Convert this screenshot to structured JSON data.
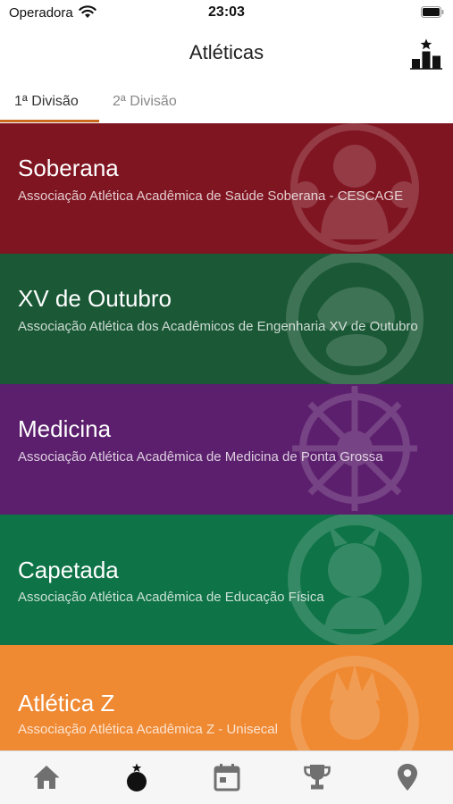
{
  "status_bar": {
    "carrier": "Operadora",
    "time": "23:03"
  },
  "header": {
    "title": "Atléticas",
    "action_icon": "ranking-podium-icon"
  },
  "tabs": [
    {
      "label": "1ª Divisão",
      "active": true
    },
    {
      "label": "2ª Divisão",
      "active": false
    }
  ],
  "colors": {
    "accent": "#c76a1e",
    "tab_bar_active": "#111111",
    "tab_bar_inactive": "#707070"
  },
  "athletics": [
    {
      "name": "Soberana",
      "description": "Associação Atlética Acadêmica de Saúde Soberana - CESCAGE",
      "color": "#7f1521"
    },
    {
      "name": "XV de Outubro",
      "description": "Associação Atlética dos Acadêmicos de Engenharia XV de Outubro",
      "color": "#1a5836"
    },
    {
      "name": "Medicina",
      "description": "Associação Atlética Acadêmica de Medicina de Ponta Grossa",
      "color": "#5c1f6d"
    },
    {
      "name": "Capetada",
      "description": "Associação Atlética Acadêmica de Educação Física",
      "color": "#0e7346"
    },
    {
      "name": "Atlética Z",
      "description": "Associação Atlética Acadêmica Z - Unisecal",
      "color": "#ef8932"
    }
  ],
  "tab_bar": [
    {
      "icon": "home-icon",
      "active": false
    },
    {
      "icon": "athletics-icon",
      "active": true
    },
    {
      "icon": "calendar-icon",
      "active": false
    },
    {
      "icon": "trophy-icon",
      "active": false
    },
    {
      "icon": "location-pin-icon",
      "active": false
    }
  ]
}
